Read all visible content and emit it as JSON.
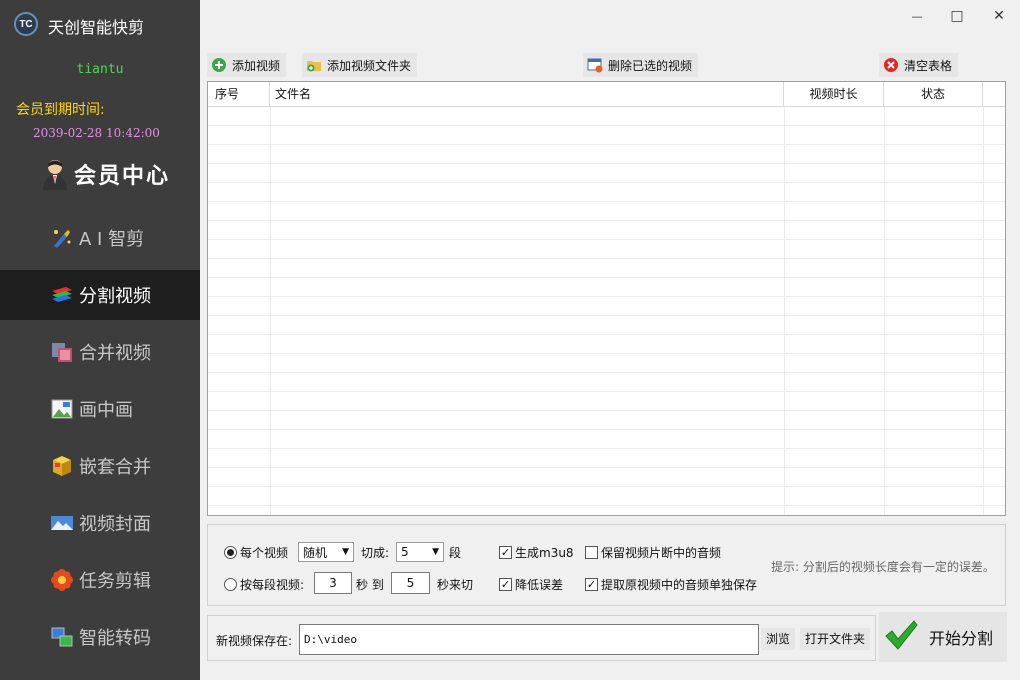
{
  "app": {
    "title": "天创智能快剪",
    "logo_text": "TC"
  },
  "user": {
    "name": "tiantu",
    "expiry_label": "会员到期时间:",
    "expiry_date": "2039-02-28 10:42:00"
  },
  "member_center": {
    "label": "会员中心"
  },
  "nav": [
    {
      "label": "A I 智剪",
      "icon": "ai-edit-icon",
      "active": false
    },
    {
      "label": "分割视频",
      "icon": "split-video-icon",
      "active": true
    },
    {
      "label": "合并视频",
      "icon": "merge-video-icon",
      "active": false
    },
    {
      "label": "画中画",
      "icon": "picture-in-picture-icon",
      "active": false
    },
    {
      "label": "嵌套合并",
      "icon": "nested-merge-icon",
      "active": false
    },
    {
      "label": "视频封面",
      "icon": "video-cover-icon",
      "active": false
    },
    {
      "label": "任务剪辑",
      "icon": "task-edit-icon",
      "active": false
    },
    {
      "label": "智能转码",
      "icon": "smart-transcode-icon",
      "active": false
    }
  ],
  "window": {
    "minimize": "—",
    "maximize": "□",
    "close": "✕"
  },
  "toolbar": {
    "add_video": "添加视频",
    "add_folder": "添加视频文件夹",
    "delete_selected": "删除已选的视频",
    "clear_table": "清空表格"
  },
  "table": {
    "columns": [
      "序号",
      "文件名",
      "视频时长",
      "状态"
    ],
    "rows": []
  },
  "options": {
    "per_video_label": "每个视频",
    "mode_value": "随机",
    "cut_label": "切成:",
    "cut_count": "5",
    "segment_unit": "段",
    "per_segment_label": "按每段视频:",
    "from_value": "3",
    "seconds_to": "秒 到",
    "to_value": "5",
    "seconds_cut": "秒来切",
    "gen_m3u8": "生成m3u8",
    "reduce_error": "降低误差",
    "keep_audio": "保留视频片断中的音频",
    "extract_audio": "提取原视频中的音频单独保存",
    "hint": "提示: 分割后的视频长度会有一定的误差。"
  },
  "save": {
    "label": "新视频保存在:",
    "path": "D:\\video",
    "browse": "浏览",
    "open_folder": "打开文件夹"
  },
  "start": {
    "label": "开始分割"
  }
}
